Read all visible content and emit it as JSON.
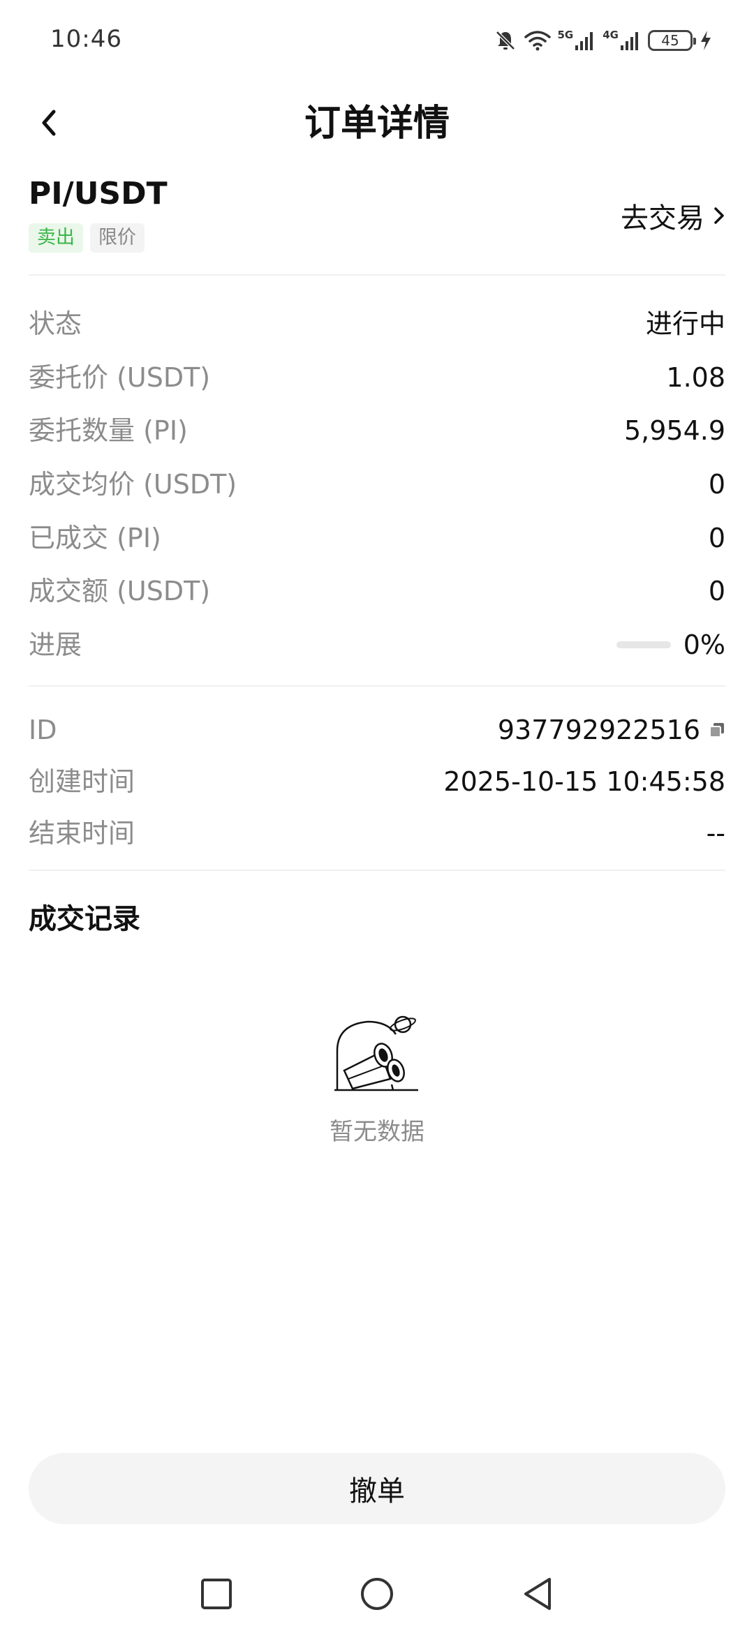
{
  "status_bar": {
    "time": "10:46",
    "network_1": "5G",
    "network_2": "4G",
    "battery": "45"
  },
  "header": {
    "title": "订单详情"
  },
  "pair": {
    "name": "PI/USDT",
    "side_tag": "卖出",
    "type_tag": "限价",
    "go_trade_label": "去交易"
  },
  "details": [
    {
      "label": "状态",
      "value": "进行中"
    },
    {
      "label": "委托价 (USDT)",
      "value": "1.08"
    },
    {
      "label": "委托数量 (PI)",
      "value": "5,954.9"
    },
    {
      "label": "成交均价 (USDT)",
      "value": "0"
    },
    {
      "label": "已成交 (PI)",
      "value": "0"
    },
    {
      "label": "成交额 (USDT)",
      "value": "0"
    },
    {
      "label": "进展",
      "value": "0%",
      "progress": 0
    }
  ],
  "meta": [
    {
      "label": "ID",
      "value": "937792922516"
    },
    {
      "label": "创建时间",
      "value": "2025-10-15 10:45:58"
    },
    {
      "label": "结束时间",
      "value": "--"
    }
  ],
  "trade_records": {
    "title": "成交记录",
    "empty_text": "暂无数据"
  },
  "actions": {
    "cancel_label": "撤单"
  },
  "colors": {
    "accent_green": "#3cb54a",
    "label_gray": "#8c8c8c",
    "button_bg": "#f4f4f4"
  }
}
